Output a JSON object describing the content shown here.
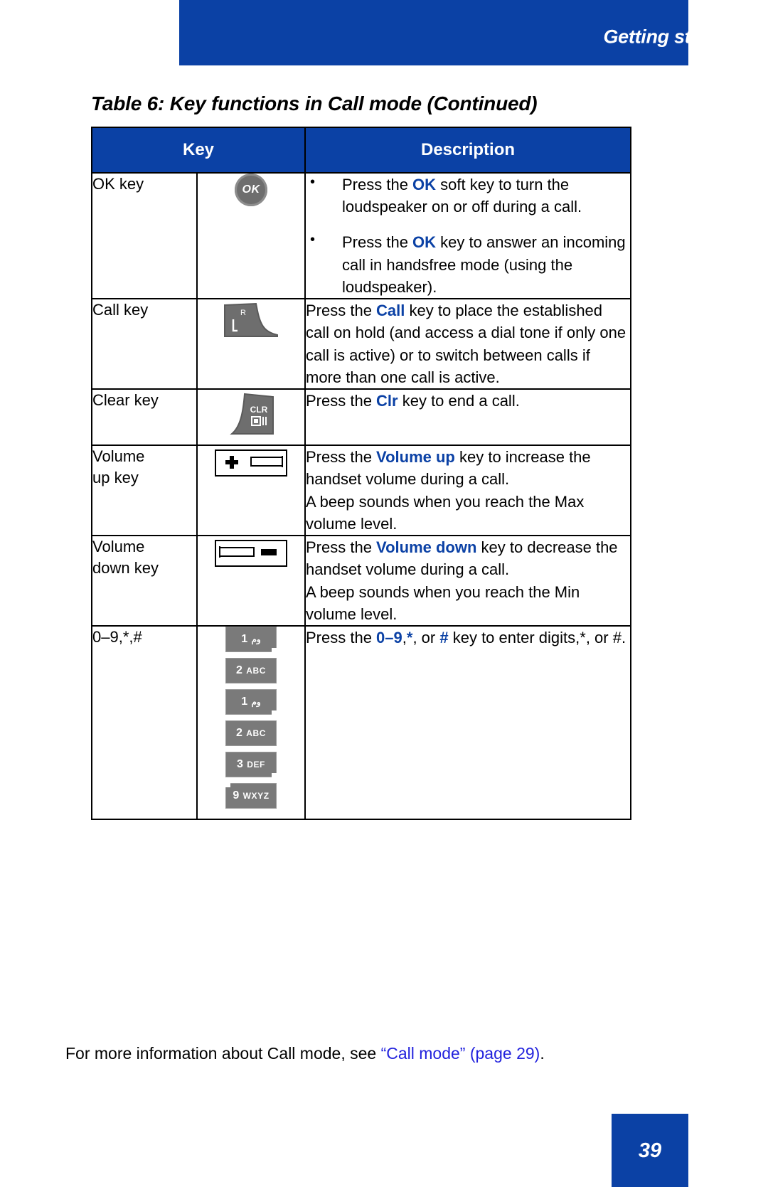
{
  "header": {
    "title": "Getting started",
    "band_color": "#0b41a5"
  },
  "table": {
    "caption": "Table 6: Key functions in Call mode (Continued)",
    "columns": [
      "Key",
      "Description"
    ],
    "rows": [
      {
        "key_name": "OK key",
        "icon": "ok-round-key-icon",
        "icon_label": "OK",
        "description_bullets": [
          {
            "parts": [
              {
                "text": "Press the ",
                "style": "normal"
              },
              {
                "text": "OK",
                "style": "blue"
              },
              {
                "text": " soft key to turn the loudspeaker on or off during a call.",
                "style": "normal"
              }
            ]
          },
          {
            "parts": [
              {
                "text": "Press the ",
                "style": "normal"
              },
              {
                "text": "OK",
                "style": "blue"
              },
              {
                "text": " key to answer an incoming call in handsfree mode (using the loudspeaker).",
                "style": "normal"
              }
            ]
          }
        ]
      },
      {
        "key_name": "Call key",
        "icon": "call-key-icon",
        "icon_label": "R",
        "description_paragraphs": [
          {
            "parts": [
              {
                "text": "Press the ",
                "style": "normal"
              },
              {
                "text": "Call",
                "style": "blue"
              },
              {
                "text": " key to place the established call on hold (and access a dial tone if only one call is active) or to switch between calls if more than one call is active.",
                "style": "normal"
              }
            ]
          }
        ]
      },
      {
        "key_name": "Clear key",
        "icon": "clear-key-icon",
        "icon_label": "CLR",
        "description_paragraphs": [
          {
            "parts": [
              {
                "text": "Press the ",
                "style": "normal"
              },
              {
                "text": "Clr",
                "style": "blue"
              },
              {
                "text": " key to end a call.",
                "style": "normal"
              }
            ]
          }
        ]
      },
      {
        "key_name": "Volume\nup key",
        "icon": "volume-up-key-icon",
        "icon_label": "+",
        "description_paragraphs": [
          {
            "parts": [
              {
                "text": "Press the ",
                "style": "normal"
              },
              {
                "text": "Volume up",
                "style": "blue"
              },
              {
                "text": " key to increase the handset volume during a call.",
                "style": "normal"
              }
            ]
          },
          {
            "parts": [
              {
                "text": "A beep sounds when you reach the Max volume level.",
                "style": "normal"
              }
            ]
          }
        ]
      },
      {
        "key_name": "Volume\ndown key",
        "icon": "volume-down-key-icon",
        "icon_label": "-",
        "description_paragraphs": [
          {
            "parts": [
              {
                "text": "Press the ",
                "style": "normal"
              },
              {
                "text": "Volume down",
                "style": "blue"
              },
              {
                "text": " key to decrease the handset volume during a call.",
                "style": "normal"
              }
            ]
          },
          {
            "parts": [
              {
                "text": "A beep sounds when you reach the Min volume level.",
                "style": "normal"
              }
            ]
          }
        ]
      },
      {
        "key_name": "0–9,*,#",
        "icon": "numeric-keypad-icon",
        "keypad_keys": [
          {
            "num": "1",
            "letters": "وم",
            "notch": "right"
          },
          {
            "num": "2",
            "letters": "ABC",
            "notch": "none"
          },
          {
            "num": "1",
            "letters": "وم",
            "notch": "right"
          },
          {
            "num": "2",
            "letters": "ABC",
            "notch": "none"
          },
          {
            "num": "3",
            "letters": "DEF",
            "notch": "right"
          },
          {
            "num": "9",
            "letters": "WXYZ",
            "notch": "left"
          }
        ],
        "description_paragraphs": [
          {
            "parts": [
              {
                "text": "Press the ",
                "style": "normal"
              },
              {
                "text": "0–9",
                "style": "blue"
              },
              {
                "text": ",",
                "style": "normal"
              },
              {
                "text": "*",
                "style": "blue"
              },
              {
                "text": ", or ",
                "style": "normal"
              },
              {
                "text": "#",
                "style": "blue"
              },
              {
                "text": " key to enter digits,*, or #.",
                "style": "normal"
              }
            ]
          }
        ]
      }
    ]
  },
  "footer": {
    "note_prefix": "For more information about Call mode, see ",
    "note_link": "“Call mode” (page 29)",
    "note_suffix": ".",
    "link_color": "#2222dd"
  },
  "page": {
    "number": "39",
    "block_color": "#0b41a5"
  }
}
